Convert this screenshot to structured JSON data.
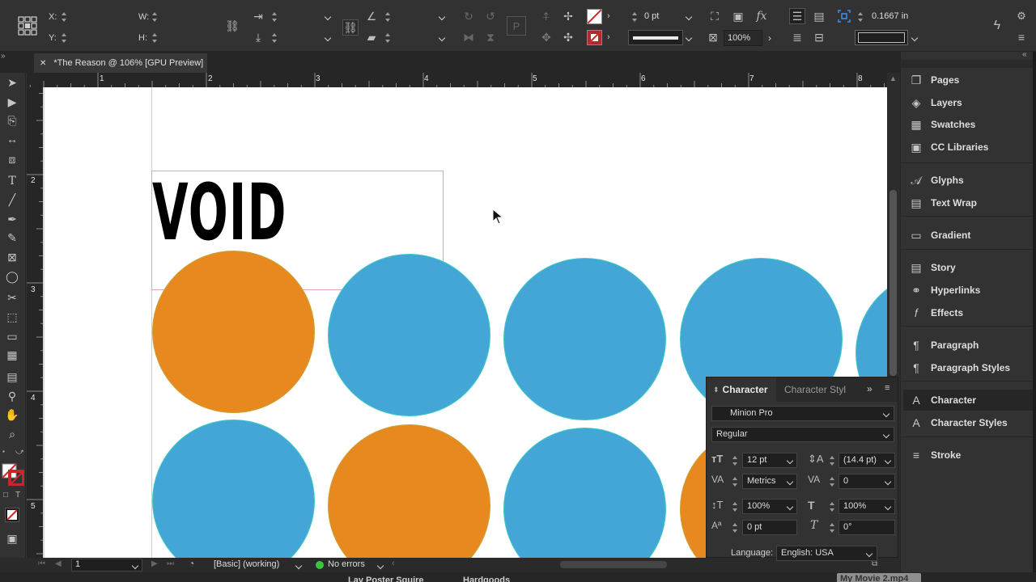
{
  "control_bar": {
    "x_label": "X:",
    "y_label": "Y:",
    "w_label": "W:",
    "h_label": "H:",
    "stroke_weight": "0 pt",
    "opacity": "100%",
    "column_value": "0.1667 in"
  },
  "document_tab": {
    "title": "*The Reason @ 106% [GPU Preview]",
    "close_glyph": "✕"
  },
  "rulers": {
    "horizontal": [
      "1",
      "2",
      "3",
      "4",
      "5",
      "6",
      "7",
      "8"
    ],
    "vertical": [
      "2",
      "3",
      "4",
      "5"
    ]
  },
  "canvas": {
    "headline_text": "VOID",
    "colors": {
      "orange": "#e8891f",
      "blue": "#44a5d7",
      "frame": "#e3a2b0"
    }
  },
  "status_bar": {
    "page_number": "1",
    "preflight_profile": "[Basic] (working)",
    "errors_text": "No errors"
  },
  "dock_peek": {
    "item1": "Lay Poster Squire",
    "item2": "Hardgoods",
    "item3": "My Movie 2.mp4"
  },
  "panels": {
    "items": [
      {
        "label": "Pages",
        "icon": "pages-icon"
      },
      {
        "label": "Layers",
        "icon": "layers-icon"
      },
      {
        "label": "Swatches",
        "icon": "swatches-icon"
      },
      {
        "label": "CC Libraries",
        "icon": "cc-libraries-icon"
      },
      {
        "label": "Glyphs",
        "icon": "glyphs-icon"
      },
      {
        "label": "Text Wrap",
        "icon": "text-wrap-icon"
      },
      {
        "label": "Gradient",
        "icon": "gradient-icon"
      },
      {
        "label": "Story",
        "icon": "story-icon"
      },
      {
        "label": "Hyperlinks",
        "icon": "hyperlinks-icon"
      },
      {
        "label": "Effects",
        "icon": "effects-icon"
      },
      {
        "label": "Paragraph",
        "icon": "paragraph-icon"
      },
      {
        "label": "Paragraph Styles",
        "icon": "paragraph-styles-icon"
      },
      {
        "label": "Character",
        "icon": "character-icon"
      },
      {
        "label": "Character Styles",
        "icon": "character-styles-icon"
      },
      {
        "label": "Stroke",
        "icon": "stroke-icon"
      }
    ]
  },
  "character_panel": {
    "tab_active": "Character",
    "tab_inactive": "Character Styl",
    "font_family": "Minion Pro",
    "font_style": "Regular",
    "font_size": "12 pt",
    "leading": "(14.4 pt)",
    "kerning": "Metrics",
    "tracking": "0",
    "vertical_scale": "100%",
    "horizontal_scale": "100%",
    "baseline_shift": "0 pt",
    "skew": "0°",
    "language_label": "Language:",
    "language_value": "English: USA"
  }
}
